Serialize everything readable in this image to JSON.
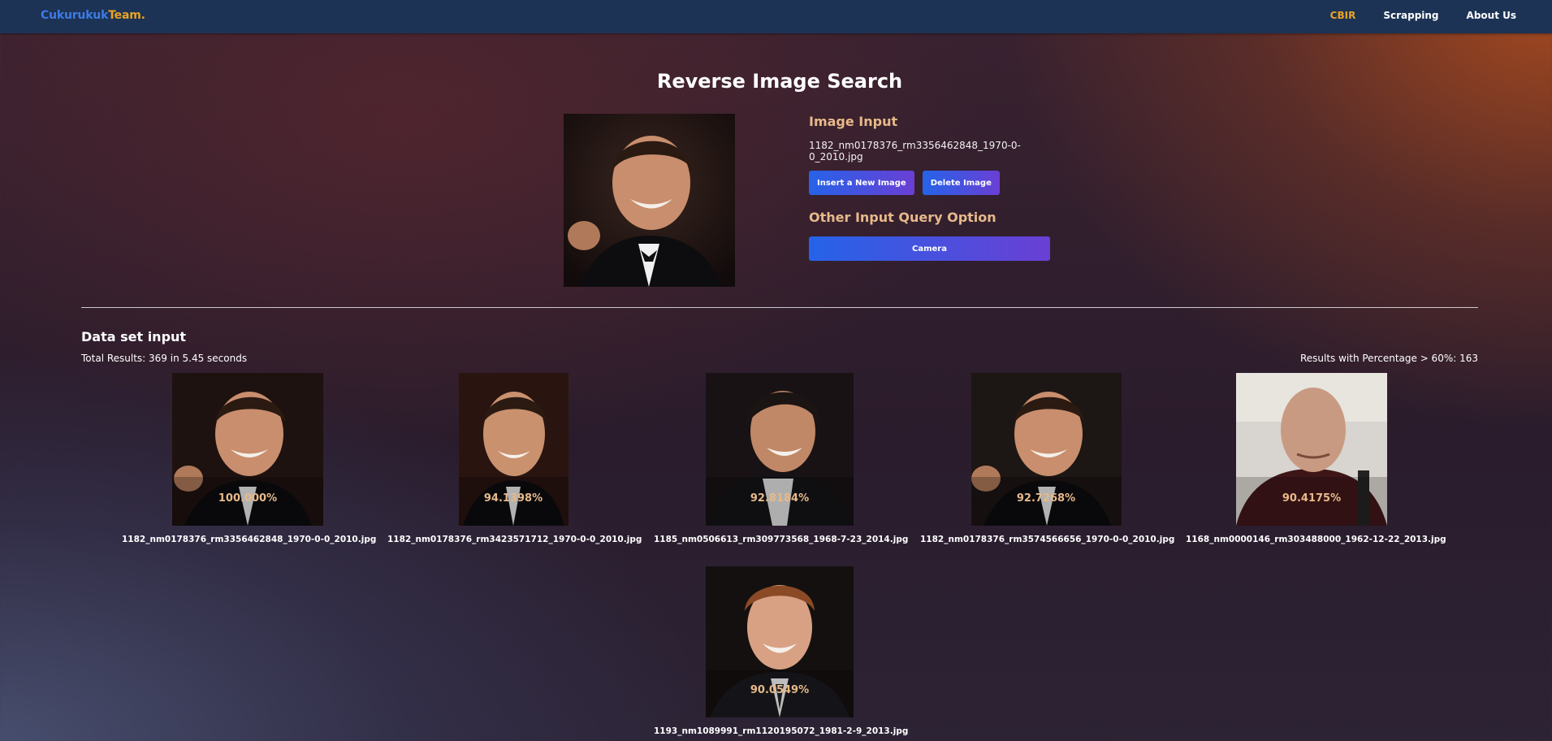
{
  "brand": {
    "part1": "Cukurukuk",
    "part2": "Team."
  },
  "nav": {
    "items": [
      {
        "label": "CBIR",
        "active": true
      },
      {
        "label": "Scrapping",
        "active": false
      },
      {
        "label": "About Us",
        "active": false
      }
    ]
  },
  "title": "Reverse Image Search",
  "input": {
    "heading": "Image Input",
    "file_name": "1182_nm0178376_rm3356462848_1970-0-0_2010.jpg",
    "insert_label": "Insert a New Image",
    "delete_label": "Delete Image",
    "other_heading": "Other Input Query Option",
    "camera_label": "Camera"
  },
  "dataset": {
    "heading": "Data set input",
    "total": "Total Results: 369 in 5.45 seconds",
    "pct_results": "Results with Percentage > 60%: 163"
  },
  "results": [
    {
      "filename": "1182_nm0178376_rm3356462848_1970-0-0_2010.jpg",
      "percentage": "100.000%"
    },
    {
      "filename": "1182_nm0178376_rm3423571712_1970-0-0_2010.jpg",
      "percentage": "94.1398%"
    },
    {
      "filename": "1185_nm0506613_rm309773568_1968-7-23_2014.jpg",
      "percentage": "92.8184%"
    },
    {
      "filename": "1182_nm0178376_rm3574566656_1970-0-0_2010.jpg",
      "percentage": "92.7268%"
    },
    {
      "filename": "1168_nm0000146_rm303488000_1962-12-22_2013.jpg",
      "percentage": "90.4175%"
    },
    {
      "filename": "1193_nm1089991_rm1120195072_1981-2-9_2013.jpg",
      "percentage": "90.0549%"
    }
  ],
  "colors": {
    "navbar": "#1c3355",
    "brand_blue": "#3d7be6",
    "accent_orange": "#e9a325",
    "heading_peach": "#e7b98a",
    "button_gradient_start": "#2563e8",
    "button_gradient_end": "#6a3fd4"
  }
}
